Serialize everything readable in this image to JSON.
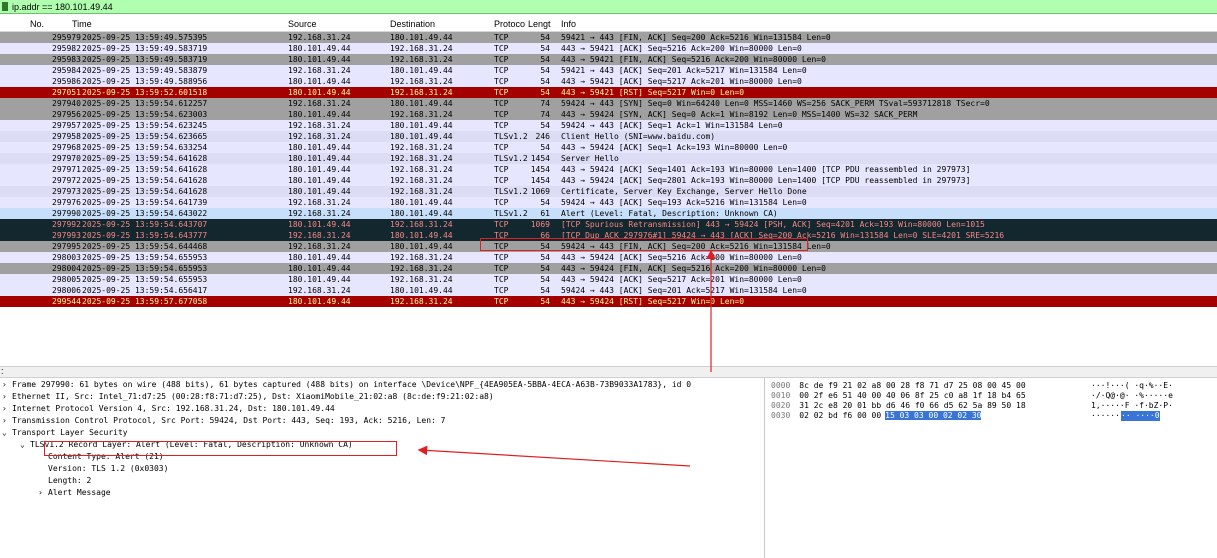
{
  "filter": {
    "value": "ip.addr == 180.101.49.44"
  },
  "columns": {
    "no": "No.",
    "time": "Time",
    "source": "Source",
    "destination": "Destination",
    "protocol": "Protoco",
    "length": "Lengt",
    "info": "Info"
  },
  "packets": [
    {
      "no": "295979",
      "time": "2025-09-25 13:59:49.575395",
      "src": "192.168.31.24",
      "dst": "180.101.49.44",
      "proto": "TCP",
      "len": "54",
      "info": "59421 → 443 [FIN, ACK] Seq=200 Ack=5216 Win=131584 Len=0",
      "style": "gray"
    },
    {
      "no": "295982",
      "time": "2025-09-25 13:59:49.583719",
      "src": "180.101.49.44",
      "dst": "192.168.31.24",
      "proto": "TCP",
      "len": "54",
      "info": "443 → 59421 [ACK] Seq=5216 Ack=200 Win=80000 Len=0",
      "style": "light"
    },
    {
      "no": "295983",
      "time": "2025-09-25 13:59:49.583719",
      "src": "180.101.49.44",
      "dst": "192.168.31.24",
      "proto": "TCP",
      "len": "54",
      "info": "443 → 59421 [FIN, ACK] Seq=5216 Ack=200 Win=80000 Len=0",
      "style": "gray"
    },
    {
      "no": "295984",
      "time": "2025-09-25 13:59:49.583879",
      "src": "192.168.31.24",
      "dst": "180.101.49.44",
      "proto": "TCP",
      "len": "54",
      "info": "59421 → 443 [ACK] Seq=201 Ack=5217 Win=131584 Len=0",
      "style": "light"
    },
    {
      "no": "295986",
      "time": "2025-09-25 13:59:49.588956",
      "src": "180.101.49.44",
      "dst": "192.168.31.24",
      "proto": "TCP",
      "len": "54",
      "info": "443 → 59421 [ACK] Seq=5217 Ack=201 Win=80000 Len=0",
      "style": "light"
    },
    {
      "no": "297051",
      "time": "2025-09-25 13:59:52.601518",
      "src": "180.101.49.44",
      "dst": "192.168.31.24",
      "proto": "TCP",
      "len": "54",
      "info": "443 → 59421 [RST] Seq=5217 Win=0 Len=0",
      "style": "red"
    },
    {
      "no": "297940",
      "time": "2025-09-25 13:59:54.612257",
      "src": "192.168.31.24",
      "dst": "180.101.49.44",
      "proto": "TCP",
      "len": "74",
      "info": "59424 → 443 [SYN] Seq=0 Win=64240 Len=0 MSS=1460 WS=256 SACK_PERM TSval=593712818 TSecr=0",
      "style": "gray"
    },
    {
      "no": "297956",
      "time": "2025-09-25 13:59:54.623003",
      "src": "180.101.49.44",
      "dst": "192.168.31.24",
      "proto": "TCP",
      "len": "74",
      "info": "443 → 59424 [SYN, ACK] Seq=0 Ack=1 Win=8192 Len=0 MSS=1400 WS=32 SACK_PERM",
      "style": "gray"
    },
    {
      "no": "297957",
      "time": "2025-09-25 13:59:54.623245",
      "src": "192.168.31.24",
      "dst": "180.101.49.44",
      "proto": "TCP",
      "len": "54",
      "info": "59424 → 443 [ACK] Seq=1 Ack=1 Win=131584 Len=0",
      "style": "light"
    },
    {
      "no": "297958",
      "time": "2025-09-25 13:59:54.623665",
      "src": "192.168.31.24",
      "dst": "180.101.49.44",
      "proto": "TLSv1.2",
      "len": "246",
      "info": "Client Hello (SNI=www.baidu.com)",
      "style": "lav"
    },
    {
      "no": "297968",
      "time": "2025-09-25 13:59:54.633254",
      "src": "180.101.49.44",
      "dst": "192.168.31.24",
      "proto": "TCP",
      "len": "54",
      "info": "443 → 59424 [ACK] Seq=1 Ack=193 Win=80000 Len=0",
      "style": "light"
    },
    {
      "no": "297970",
      "time": "2025-09-25 13:59:54.641628",
      "src": "180.101.49.44",
      "dst": "192.168.31.24",
      "proto": "TLSv1.2",
      "len": "1454",
      "info": "Server Hello",
      "style": "lav"
    },
    {
      "no": "297971",
      "time": "2025-09-25 13:59:54.641628",
      "src": "180.101.49.44",
      "dst": "192.168.31.24",
      "proto": "TCP",
      "len": "1454",
      "info": "443 → 59424 [ACK] Seq=1401 Ack=193 Win=80000 Len=1400 [TCP PDU reassembled in 297973]",
      "style": "light"
    },
    {
      "no": "297972",
      "time": "2025-09-25 13:59:54.641628",
      "src": "180.101.49.44",
      "dst": "192.168.31.24",
      "proto": "TCP",
      "len": "1454",
      "info": "443 → 59424 [ACK] Seq=2801 Ack=193 Win=80000 Len=1400 [TCP PDU reassembled in 297973]",
      "style": "light"
    },
    {
      "no": "297973",
      "time": "2025-09-25 13:59:54.641628",
      "src": "180.101.49.44",
      "dst": "192.168.31.24",
      "proto": "TLSv1.2",
      "len": "1069",
      "info": "Certificate, Server Key Exchange, Server Hello Done",
      "style": "lav"
    },
    {
      "no": "297976",
      "time": "2025-09-25 13:59:54.641739",
      "src": "192.168.31.24",
      "dst": "180.101.49.44",
      "proto": "TCP",
      "len": "54",
      "info": "59424 → 443 [ACK] Seq=193 Ack=5216 Win=131584 Len=0",
      "style": "light"
    },
    {
      "no": "297990",
      "time": "2025-09-25 13:59:54.643022",
      "src": "192.168.31.24",
      "dst": "180.101.49.44",
      "proto": "TLSv1.2",
      "len": "61",
      "info": "Alert (Level: Fatal, Description: Unknown CA)",
      "style": "sel"
    },
    {
      "no": "297992",
      "time": "2025-09-25 13:59:54.643707",
      "src": "180.101.49.44",
      "dst": "192.168.31.24",
      "proto": "TCP",
      "len": "1069",
      "info": "[TCP Spurious Retransmission] 443 → 59424 [PSH, ACK] Seq=4201 Ack=193 Win=80000 Len=1015",
      "style": "dark"
    },
    {
      "no": "297993",
      "time": "2025-09-25 13:59:54.643777",
      "src": "192.168.31.24",
      "dst": "180.101.49.44",
      "proto": "TCP",
      "len": "66",
      "info": "[TCP Dup ACK 297976#1] 59424 → 443 [ACK] Seq=200 Ack=5216 Win=131584 Len=0 SLE=4201 SRE=5216",
      "style": "dark"
    },
    {
      "no": "297995",
      "time": "2025-09-25 13:59:54.644468",
      "src": "192.168.31.24",
      "dst": "180.101.49.44",
      "proto": "TCP",
      "len": "54",
      "info": "59424 → 443 [FIN, ACK] Seq=200 Ack=5216 Win=131584 Len=0",
      "style": "gray"
    },
    {
      "no": "298003",
      "time": "2025-09-25 13:59:54.655953",
      "src": "180.101.49.44",
      "dst": "192.168.31.24",
      "proto": "TCP",
      "len": "54",
      "info": "443 → 59424 [ACK] Seq=5216 Ack=200 Win=80000 Len=0",
      "style": "light"
    },
    {
      "no": "298004",
      "time": "2025-09-25 13:59:54.655953",
      "src": "180.101.49.44",
      "dst": "192.168.31.24",
      "proto": "TCP",
      "len": "54",
      "info": "443 → 59424 [FIN, ACK] Seq=5216 Ack=200 Win=80000 Len=0",
      "style": "gray"
    },
    {
      "no": "298005",
      "time": "2025-09-25 13:59:54.655953",
      "src": "180.101.49.44",
      "dst": "192.168.31.24",
      "proto": "TCP",
      "len": "54",
      "info": "443 → 59424 [ACK] Seq=5217 Ack=201 Win=80000 Len=0",
      "style": "light"
    },
    {
      "no": "298006",
      "time": "2025-09-25 13:59:54.656417",
      "src": "192.168.31.24",
      "dst": "180.101.49.44",
      "proto": "TCP",
      "len": "54",
      "info": "59424 → 443 [ACK] Seq=201 Ack=5217 Win=131584 Len=0",
      "style": "light"
    },
    {
      "no": "299544",
      "time": "2025-09-25 13:59:57.677058",
      "src": "180.101.49.44",
      "dst": "192.168.31.24",
      "proto": "TCP",
      "len": "54",
      "info": "443 → 59424 [RST] Seq=5217 Win=0 Len=0",
      "style": "red"
    }
  ],
  "details": [
    {
      "text": "Frame 297990: 61 bytes on wire (488 bits), 61 bytes captured (488 bits) on interface \\Device\\NPF_{4EA905EA-5BBA-4ECA-A63B-73B9033A1783}, id 0",
      "indent": 0,
      "arrow": "›"
    },
    {
      "text": "Ethernet II, Src: Intel_71:d7:25 (00:28:f8:71:d7:25), Dst: XiaomiMobile_21:02:a8 (8c:de:f9:21:02:a8)",
      "indent": 0,
      "arrow": "›"
    },
    {
      "text": "Internet Protocol Version 4, Src: 192.168.31.24, Dst: 180.101.49.44",
      "indent": 0,
      "arrow": "›"
    },
    {
      "text": "Transmission Control Protocol, Src Port: 59424, Dst Port: 443, Seq: 193, Ack: 5216, Len: 7",
      "indent": 0,
      "arrow": "›"
    },
    {
      "text": "Transport Layer Security",
      "indent": 0,
      "arrow": "⌄"
    },
    {
      "text": "TLSv1.2 Record Layer: Alert (Level: Fatal, Description: Unknown CA)",
      "indent": 1,
      "arrow": "⌄"
    },
    {
      "text": "Content Type: Alert (21)",
      "indent": 2,
      "arrow": ""
    },
    {
      "text": "Version: TLS 1.2 (0x0303)",
      "indent": 2,
      "arrow": ""
    },
    {
      "text": "Length: 2",
      "indent": 2,
      "arrow": ""
    },
    {
      "text": "Alert Message",
      "indent": 2,
      "arrow": "›"
    }
  ],
  "hex": [
    {
      "offset": "0000",
      "bytes": "8c de f9 21 02 a8 00 28  f8 71 d7 25 08 00 45 00",
      "ascii": "···!···( ·q·%··E·"
    },
    {
      "offset": "0010",
      "bytes": "00 2f e6 51 40 00 40 06  8f 25 c0 a8 1f 18 b4 65",
      "ascii": "·/·Q@·@· ·%·····e"
    },
    {
      "offset": "0020",
      "bytes": "31 2c e8 20 01 bb d6 46  f0 66 d5 62 5a 89 50 18",
      "ascii": "1,·····F ·f·bZ·P·"
    },
    {
      "offset": "0030",
      "bytes": "02 02 bd f6 00 00",
      "bytes_hl": "15 03  03 00 02 02 30",
      "ascii": "······",
      "ascii_hl": "·· ····0"
    }
  ],
  "colors": {
    "filter_bg": "#afffaf",
    "gray": "#a0a0a0",
    "red": "#a40000",
    "dark": "#12272e",
    "selected": "#c7dffa",
    "annotation": "#e02020"
  }
}
